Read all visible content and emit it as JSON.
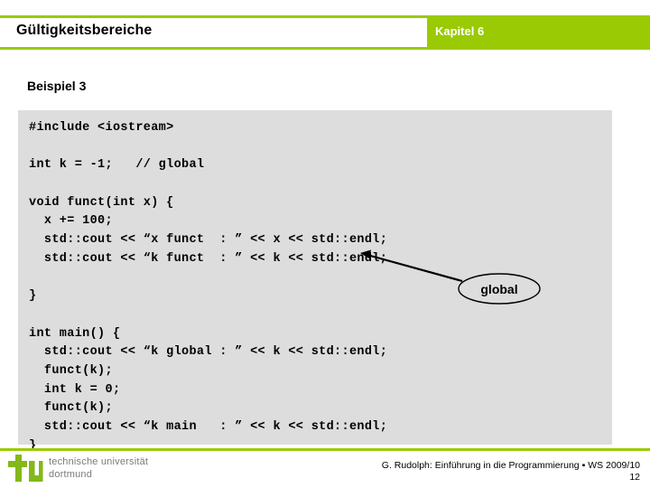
{
  "header": {
    "title": "Gültigkeitsbereiche",
    "chapter": "Kapitel 6",
    "accent_color": "#9ACA03"
  },
  "slide": {
    "subtitle": "Beispiel 3"
  },
  "code": {
    "background_color": "#DDDDDD",
    "lines": [
      "#include <iostream>",
      "",
      "int k = -1;   // global",
      "",
      "void funct(int x) {",
      "  x += 100;",
      "  std::cout << “x funct  : ” << x << std::endl;",
      "  std::cout << “k funct  : ” << k << std::endl;",
      "",
      "}",
      "",
      "int main() {",
      "  std::cout << “k global : ” << k << std::endl;",
      "  funct(k);",
      "  int k = 0;",
      "  funct(k);",
      "  std::cout << “k main   : ” << k << std::endl;",
      "}"
    ]
  },
  "annotation": {
    "label": "global"
  },
  "footer": {
    "logo_mark": "tu-logo-icon",
    "logo_line1": "technische universität",
    "logo_line2": "dortmund",
    "credit": "G. Rudolph: Einführung in die Programmierung ▪ WS 2009/10",
    "page_number": "12"
  }
}
